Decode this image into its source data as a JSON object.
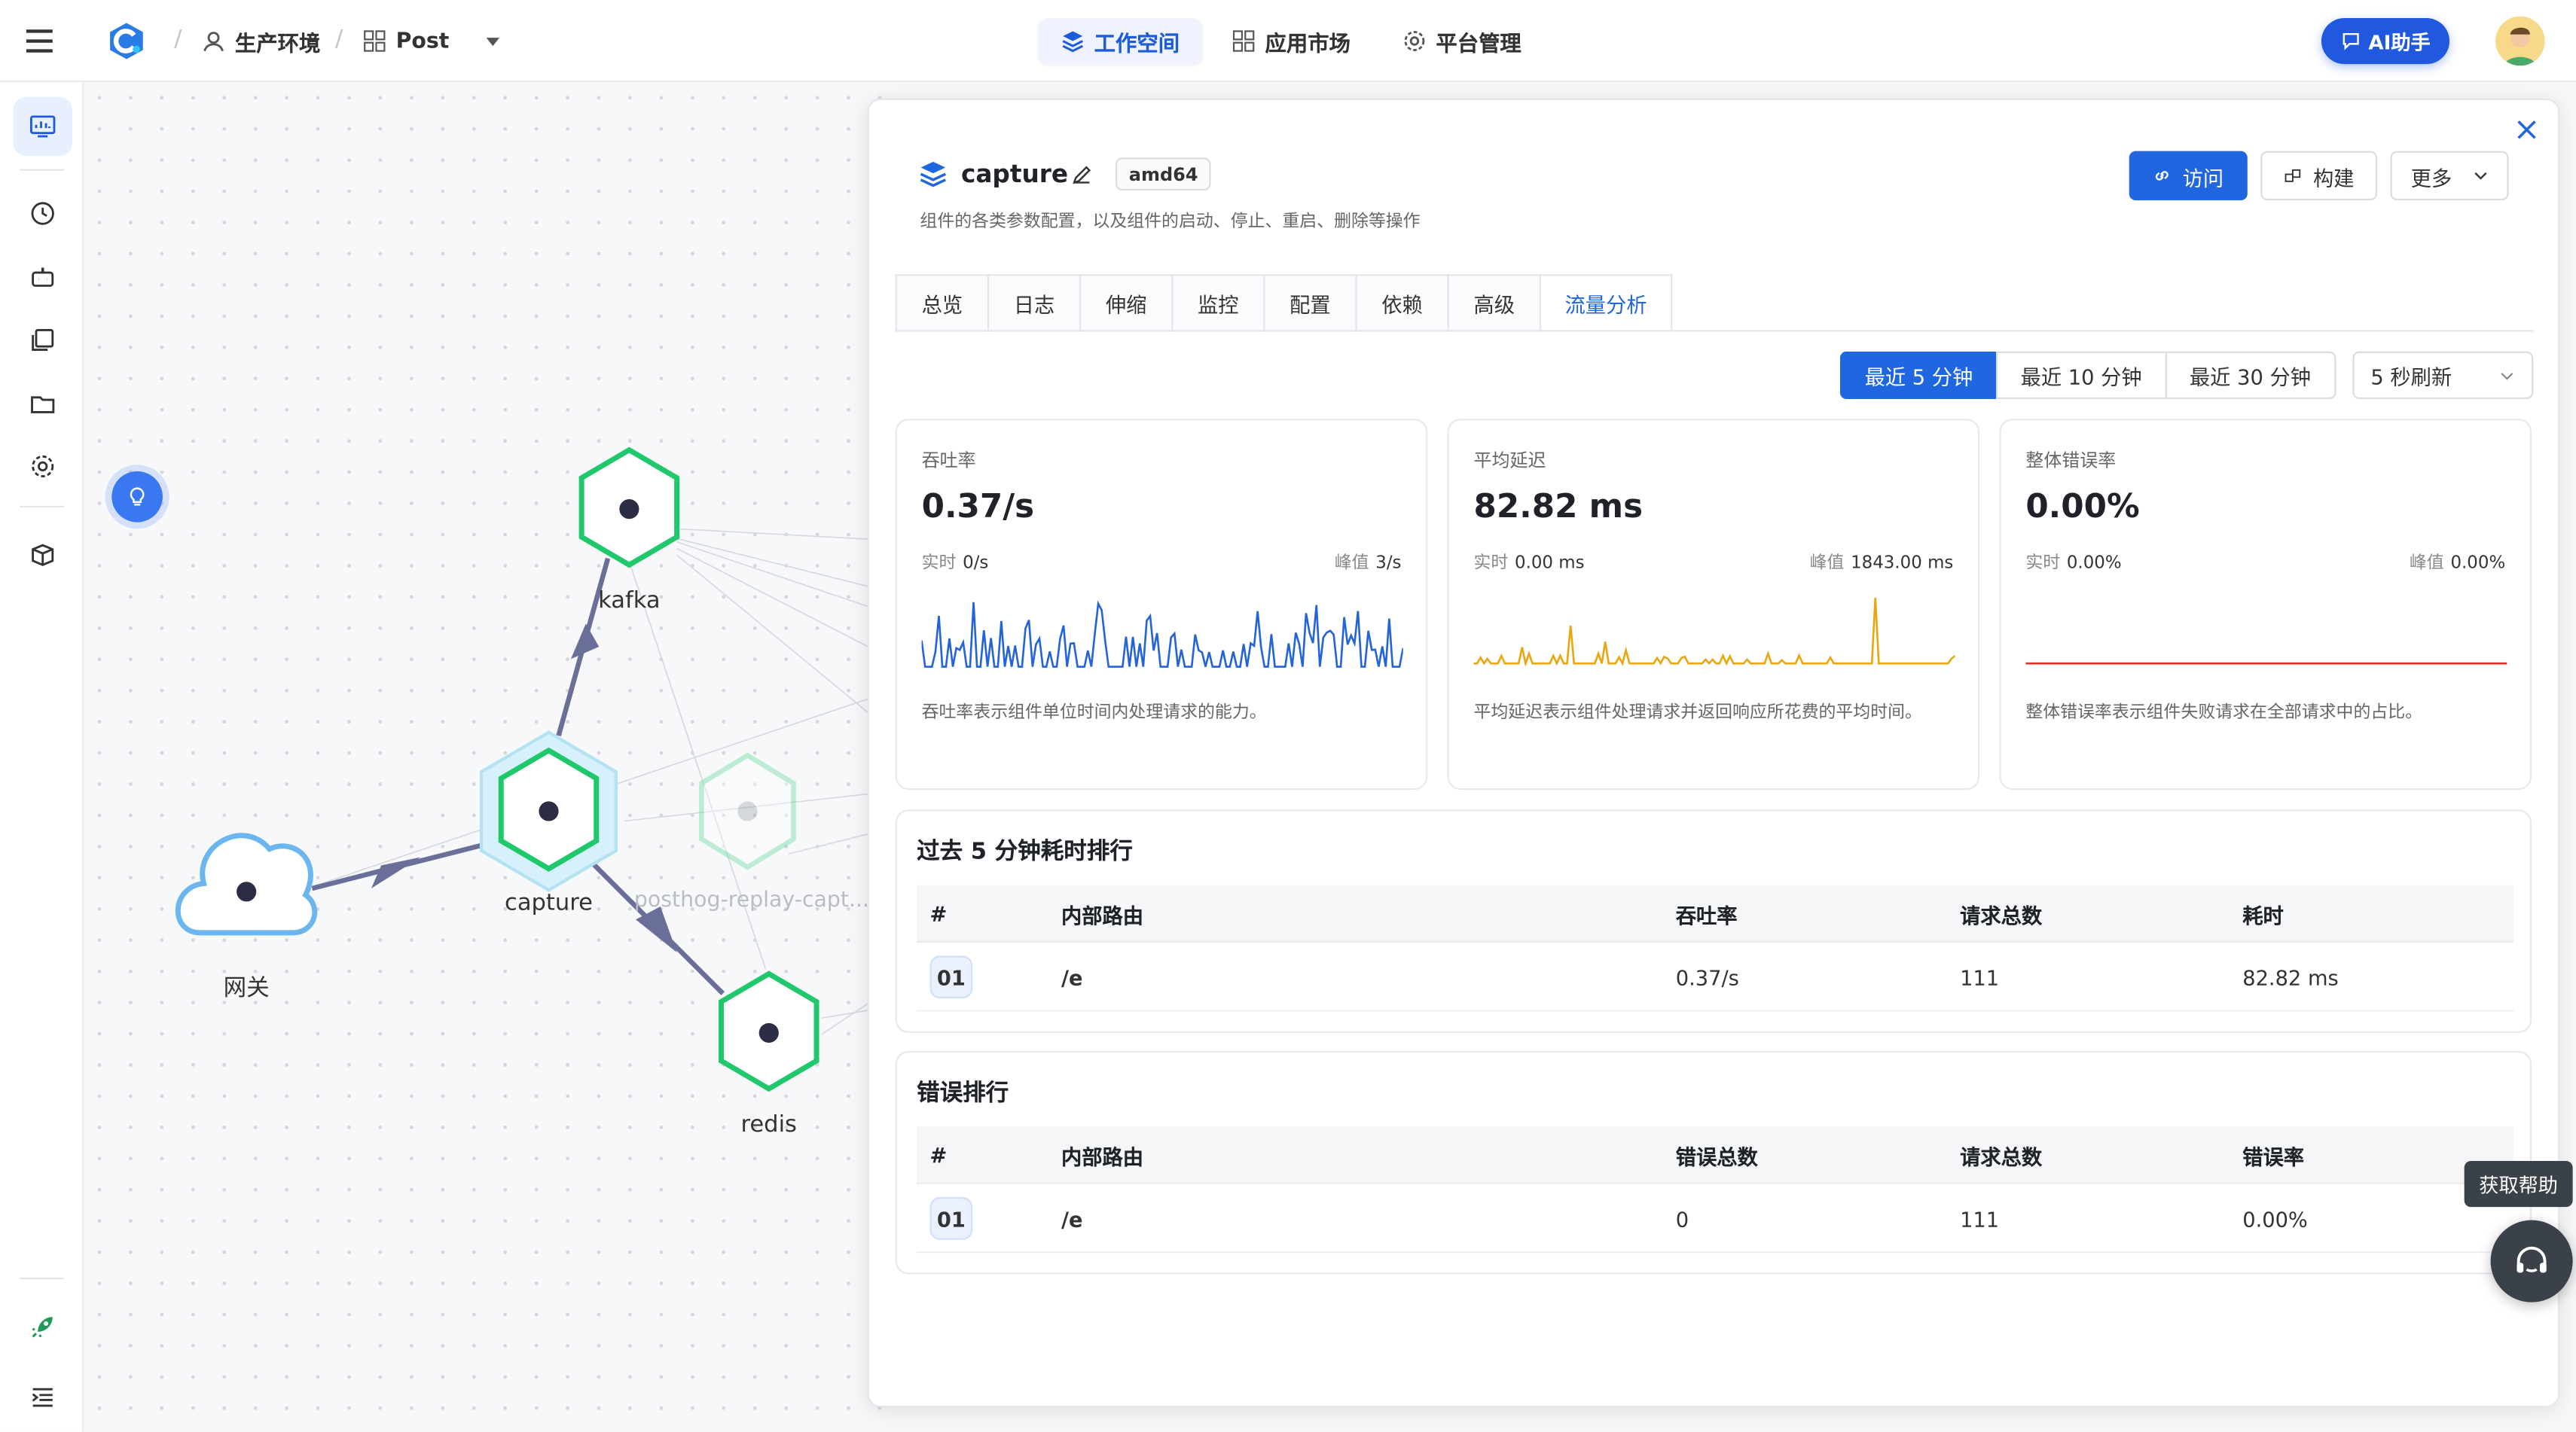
{
  "header": {
    "breadcrumb": [
      {
        "label": "生产环境",
        "icon": "user-icon"
      },
      {
        "label": "Post",
        "icon": "grid-icon"
      }
    ],
    "nav": [
      {
        "label": "工作空间",
        "icon": "layers-icon",
        "active": true
      },
      {
        "label": "应用市场",
        "icon": "grid-icon",
        "active": false
      },
      {
        "label": "平台管理",
        "icon": "gear-icon",
        "active": false
      }
    ],
    "ai_label": "AI助手"
  },
  "topology": {
    "nodes": [
      {
        "label": "kafka"
      },
      {
        "label": "capture"
      },
      {
        "label": "posthog-replay-capt..."
      },
      {
        "label": "redis"
      },
      {
        "label": "网关"
      }
    ]
  },
  "panel": {
    "component_name": "capture",
    "arch": "amd64",
    "subtitle": "组件的各类参数配置，以及组件的启动、停止、重启、删除等操作",
    "actions": {
      "visit": "访问",
      "build": "构建",
      "more": "更多"
    },
    "tabs": [
      "总览",
      "日志",
      "伸缩",
      "监控",
      "配置",
      "依赖",
      "高级",
      "流量分析"
    ],
    "active_tab": "流量分析",
    "ranges": [
      "最近 5 分钟",
      "最近 10 分钟",
      "最近 30 分钟"
    ],
    "active_range": "最近 5 分钟",
    "refresh": "5 秒刷新",
    "metrics": {
      "throughput": {
        "label": "吞吐率",
        "value": "0.37/s",
        "realtime_k": "实时",
        "realtime_v": "0/s",
        "peak_k": "峰值",
        "peak_v": "3/s",
        "desc": "吞吐率表示组件单位时间内处理请求的能力。",
        "color": "#2563d8"
      },
      "latency": {
        "label": "平均延迟",
        "value": "82.82 ms",
        "realtime_k": "实时",
        "realtime_v": "0.00 ms",
        "peak_k": "峰值",
        "peak_v": "1843.00 ms",
        "desc": "平均延迟表示组件处理请求并返回响应所花费的平均时间。",
        "color": "#e8a711"
      },
      "errors": {
        "label": "整体错误率",
        "value": "0.00%",
        "realtime_k": "实时",
        "realtime_v": "0.00%",
        "peak_k": "峰值",
        "peak_v": "0.00%",
        "desc": "整体错误率表示组件失败请求在全部请求中的占比。",
        "color": "#d93025"
      }
    },
    "slow_table": {
      "title": "过去 5 分钟耗时排行",
      "headers": [
        "#",
        "内部路由",
        "吞吐率",
        "请求总数",
        "耗时"
      ],
      "rows": [
        [
          "01",
          "/e",
          "0.37/s",
          "111",
          "82.82 ms"
        ]
      ]
    },
    "error_table": {
      "title": "错误排行",
      "headers": [
        "#",
        "内部路由",
        "错误总数",
        "请求总数",
        "错误率"
      ],
      "rows": [
        [
          "01",
          "/e",
          "0",
          "111",
          "0.00%"
        ]
      ]
    }
  },
  "help": {
    "tooltip": "获取帮助"
  }
}
